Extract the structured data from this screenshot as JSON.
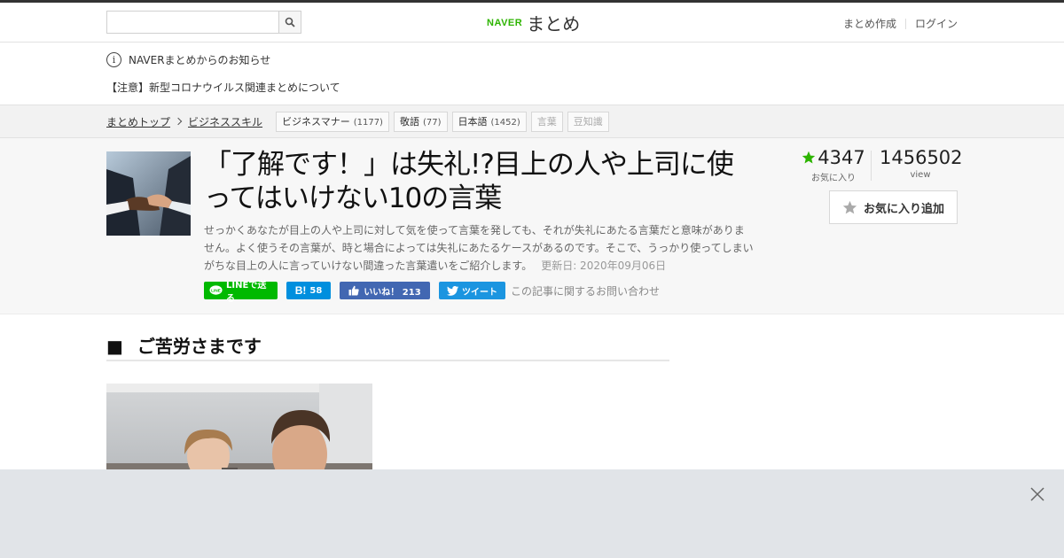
{
  "header": {
    "search_placeholder": "",
    "logo_naver": "NAVER",
    "logo_matome": "まとめ",
    "links": {
      "create": "まとめ作成",
      "login": "ログイン"
    }
  },
  "notice": {
    "title": "NAVERまとめからのお知らせ",
    "link": "【注意】新型コロナウイルス関連まとめについて"
  },
  "breadcrumb": {
    "items": [
      "まとめトップ",
      "ビジネススキル"
    ],
    "tags": [
      {
        "label": "ビジネスマナー",
        "count": "(1177)"
      },
      {
        "label": "敬語",
        "count": "(77)"
      },
      {
        "label": "日本語",
        "count": "(1452)"
      },
      {
        "label": "言葉",
        "count": ""
      },
      {
        "label": "豆知識",
        "count": ""
      }
    ]
  },
  "article": {
    "title": "「了解です！」は失礼!?目上の人や上司に使ってはいけない10の言葉",
    "description": "せっかくあなたが目上の人や上司に対して気を使って言葉を発しても、それが失礼にあたる言葉だと意味がありません。よく使うその言葉が、時と場合によっては失礼にあたるケースがあるのです。そこで、うっかり使ってしまいがちな目上の人に言っていけない間違った言葉遣いをご紹介します。",
    "updated": "更新日: 2020年09月06日",
    "favorites": "4347",
    "favorites_label": "お気に入り",
    "views": "1456502",
    "views_label": "view",
    "fav_button": "お気に入り追加",
    "share": {
      "line": "LINEで送る",
      "hatena": "58",
      "facebook": "いいね！ 213",
      "twitter": "ツイート"
    },
    "contact": "この記事に関するお問い合わせ"
  },
  "section": {
    "bullet": "■",
    "heading": "ご苦労さまです"
  },
  "colors": {
    "accent": "#2db400",
    "line": "#00b900",
    "hatena": "#008fde",
    "facebook": "#4267b2",
    "twitter": "#1b95e0"
  }
}
